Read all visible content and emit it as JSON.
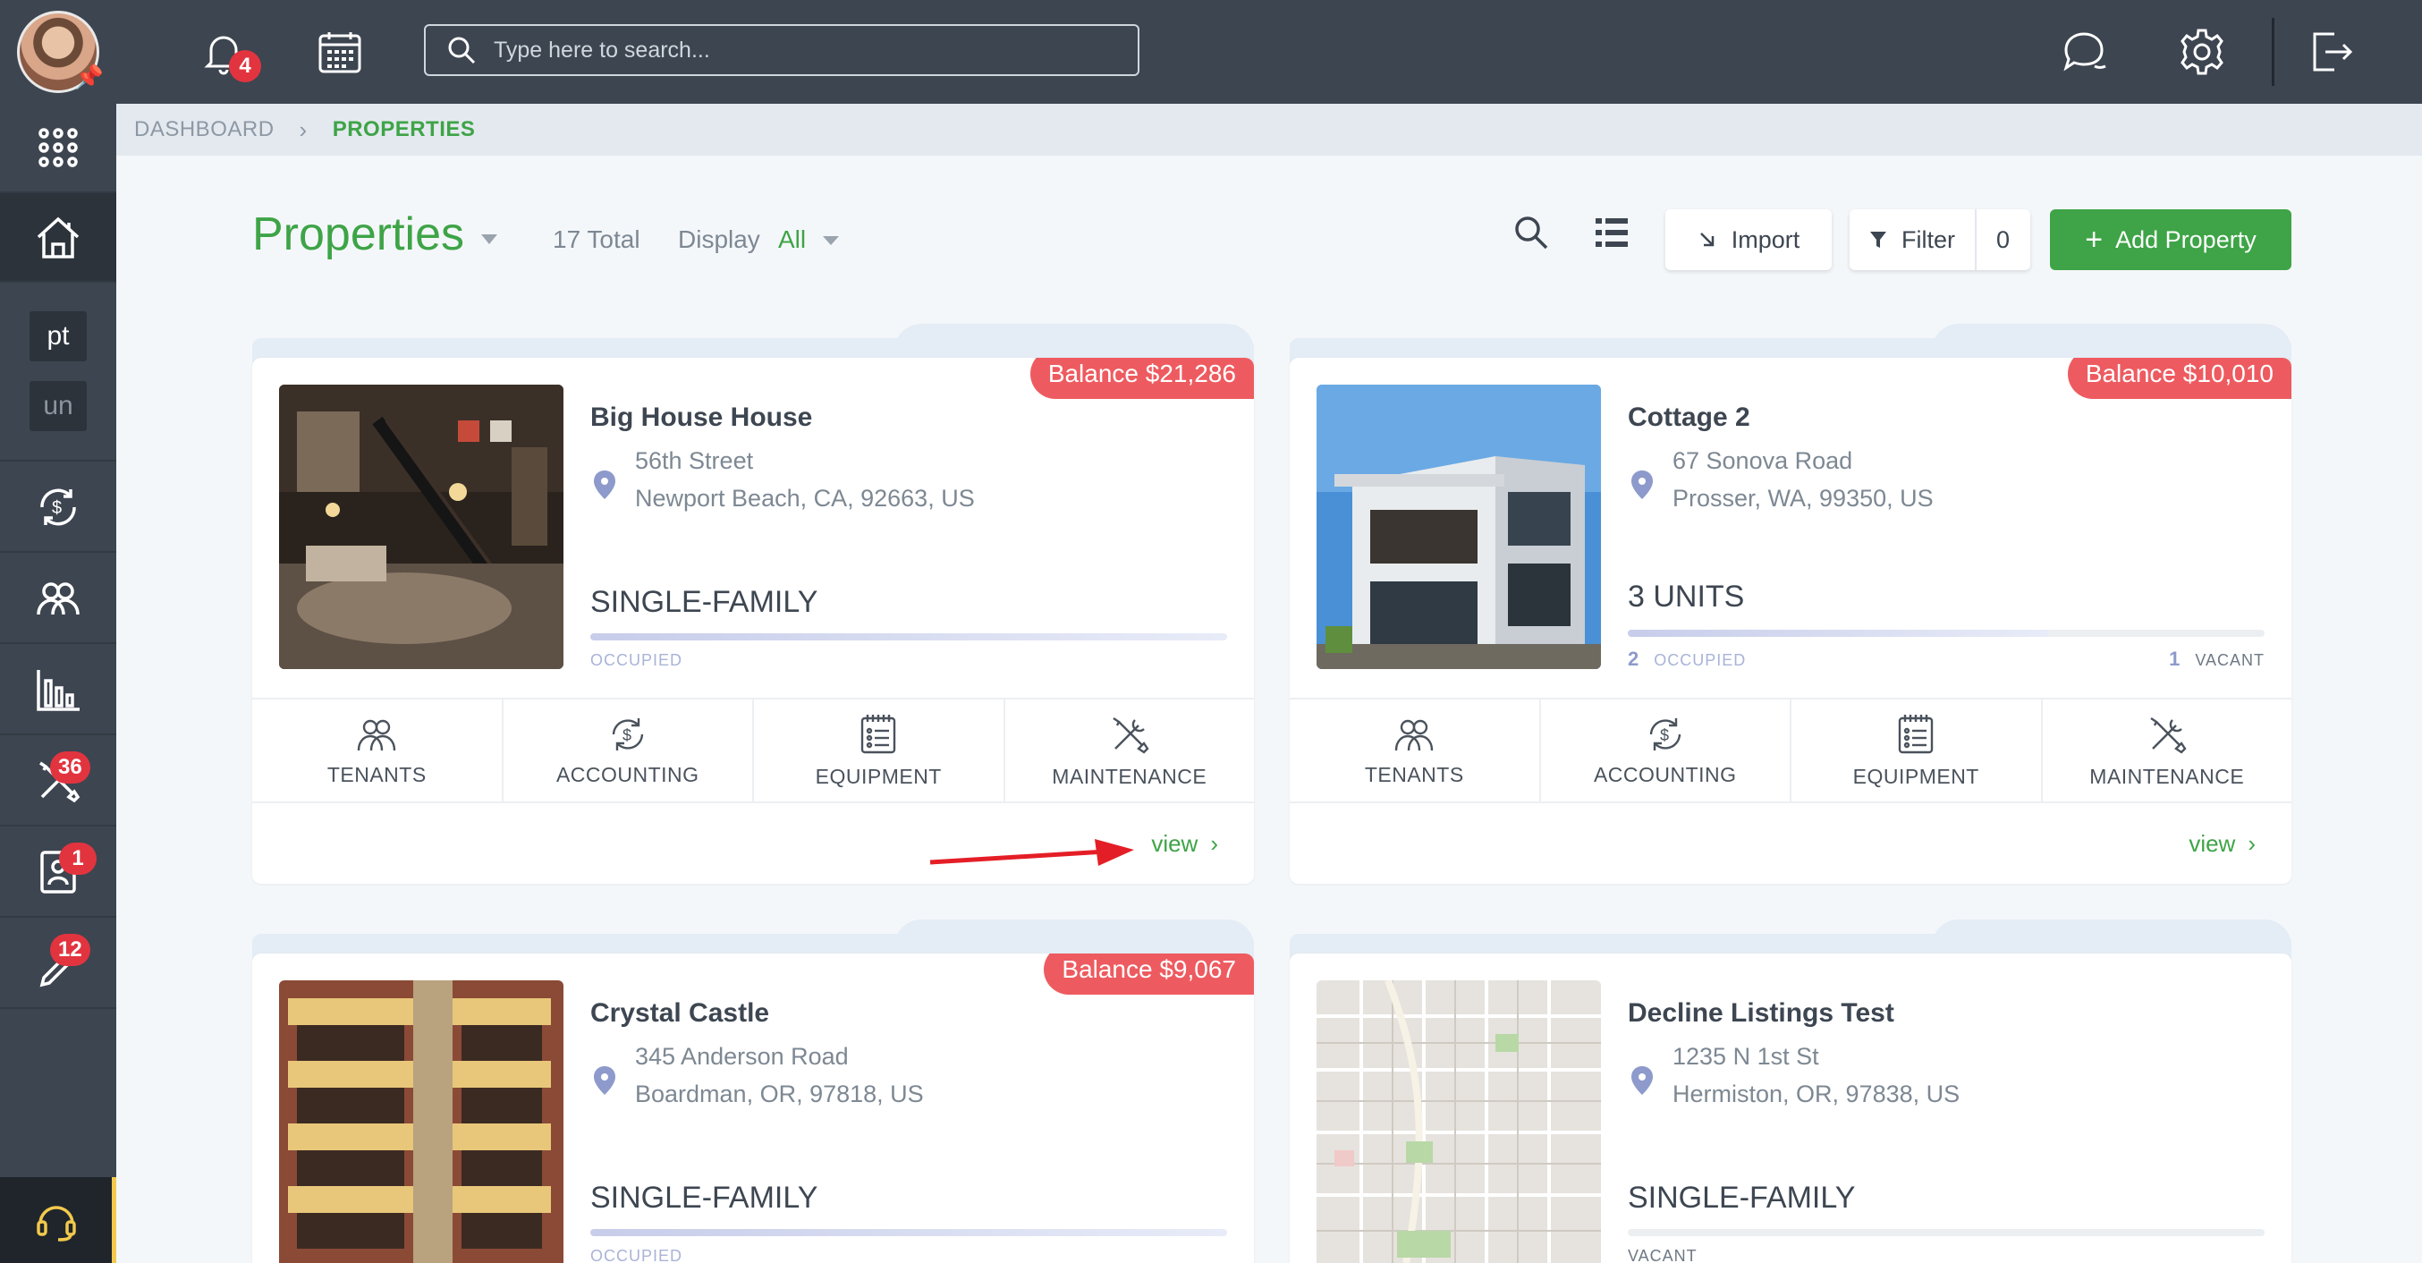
{
  "sidebar": {
    "items": [
      {
        "name": "apps",
        "icon": "grid-dots-icon"
      },
      {
        "name": "properties",
        "icon": "house-icon",
        "active": true
      },
      {
        "name": "pt",
        "label": "pt"
      },
      {
        "name": "un",
        "label": "un"
      },
      {
        "name": "accounting",
        "icon": "money-cycle-icon"
      },
      {
        "name": "people",
        "icon": "people-icon"
      },
      {
        "name": "reports",
        "icon": "bar-chart-icon"
      },
      {
        "name": "maintenance",
        "icon": "tools-icon",
        "badge": "36"
      },
      {
        "name": "applications",
        "icon": "contact-icon",
        "badge": "1"
      },
      {
        "name": "tasks",
        "icon": "pen-icon",
        "badge": "12"
      },
      {
        "name": "support",
        "icon": "headset-icon"
      }
    ]
  },
  "topbar": {
    "notifications_badge": "4",
    "search_placeholder": "Type here to search..."
  },
  "breadcrumb": {
    "root": "DASHBOARD",
    "current": "PROPERTIES"
  },
  "header": {
    "title": "Properties",
    "total": "17 Total",
    "display_label": "Display",
    "display_value": "All",
    "import_label": "Import",
    "filter_label": "Filter",
    "filter_count": "0",
    "add_label": "Add Property"
  },
  "colors": {
    "accent": "#3ea447",
    "balance": "#ed5b60",
    "chrome": "#3d4550"
  },
  "cards": [
    {
      "name": "Big House House",
      "balance": "Balance $21,286",
      "street": "56th Street",
      "city": "Newport Beach, CA, 92663, US",
      "type": "SINGLE-FAMILY",
      "occupied_label": "OCCUPIED",
      "occupancy": 1.0,
      "actions": [
        "TENANTS",
        "ACCOUNTING",
        "EQUIPMENT",
        "MAINTENANCE"
      ],
      "view": "view"
    },
    {
      "name": "Cottage 2",
      "balance": "Balance $10,010",
      "street": "67 Sonova Road",
      "city": "Prosser, WA, 99350, US",
      "type": "3 UNITS",
      "occupied_count": "2",
      "occupied_label": "OCCUPIED",
      "vacant_count": "1",
      "vacant_label": "VACANT",
      "occupancy": 0.667,
      "actions": [
        "TENANTS",
        "ACCOUNTING",
        "EQUIPMENT",
        "MAINTENANCE"
      ],
      "view": "view"
    },
    {
      "name": "Crystal Castle",
      "balance": "Balance $9,067",
      "street": "345 Anderson Road",
      "city": "Boardman, OR, 97818, US",
      "type": "SINGLE-FAMILY",
      "occupied_label": "OCCUPIED",
      "occupancy": 1.0
    },
    {
      "name": "Decline Listings Test",
      "street": "1235 N 1st St",
      "city": "Hermiston, OR, 97838, US",
      "type": "SINGLE-FAMILY",
      "vacant_label": "VACANT",
      "occupancy": 0.0
    }
  ]
}
